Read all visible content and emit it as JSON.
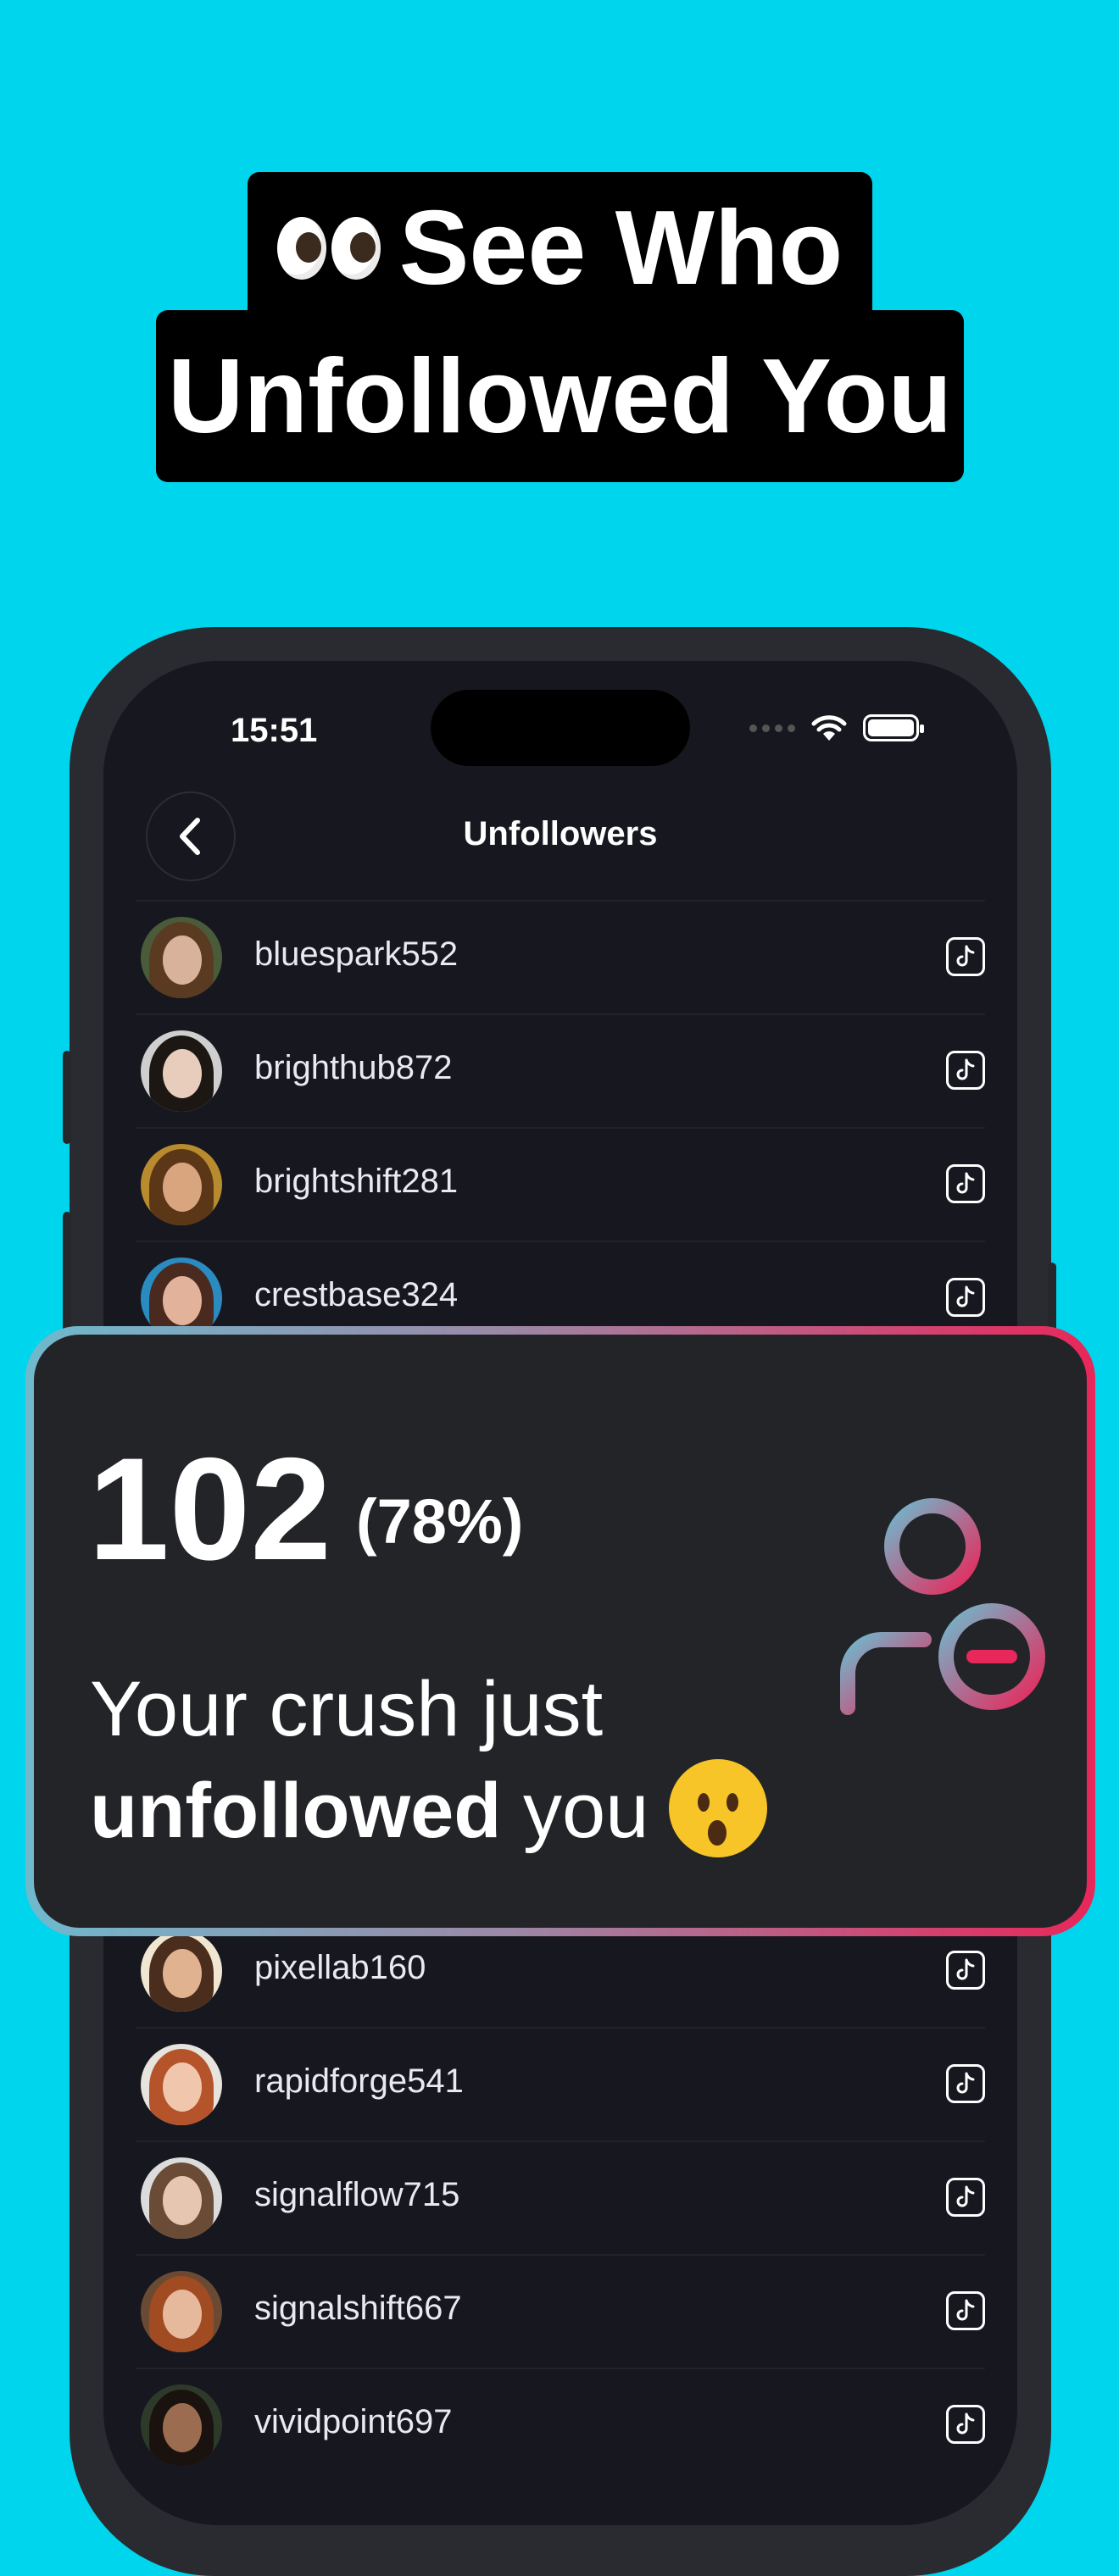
{
  "headline": {
    "line1": "See Who",
    "line2": "Unfollowed You",
    "icon": "eyes-emoji"
  },
  "status_bar": {
    "time": "15:51"
  },
  "nav": {
    "title": "Unfollowers"
  },
  "unfollowers_top": [
    {
      "username": "bluespark552"
    },
    {
      "username": "brighthub872"
    },
    {
      "username": "brightshift281"
    },
    {
      "username": "crestbase324"
    }
  ],
  "unfollowers_bottom": [
    {
      "username": "pixellab160"
    },
    {
      "username": "rapidforge541"
    },
    {
      "username": "signalflow715"
    },
    {
      "username": "signalshift667"
    },
    {
      "username": "vividpoint697"
    }
  ],
  "card": {
    "count": "102",
    "percent": "(78%)",
    "line1": "Your crush just",
    "line2_bold": "unfollowed",
    "line2_rest": " you",
    "emoji": "astonished-face-emoji",
    "icon": "user-remove-icon"
  },
  "colors": {
    "background": "#00d5ee",
    "card_gradient_start": "#6fb9cd",
    "card_gradient_end": "#e8275a"
  }
}
